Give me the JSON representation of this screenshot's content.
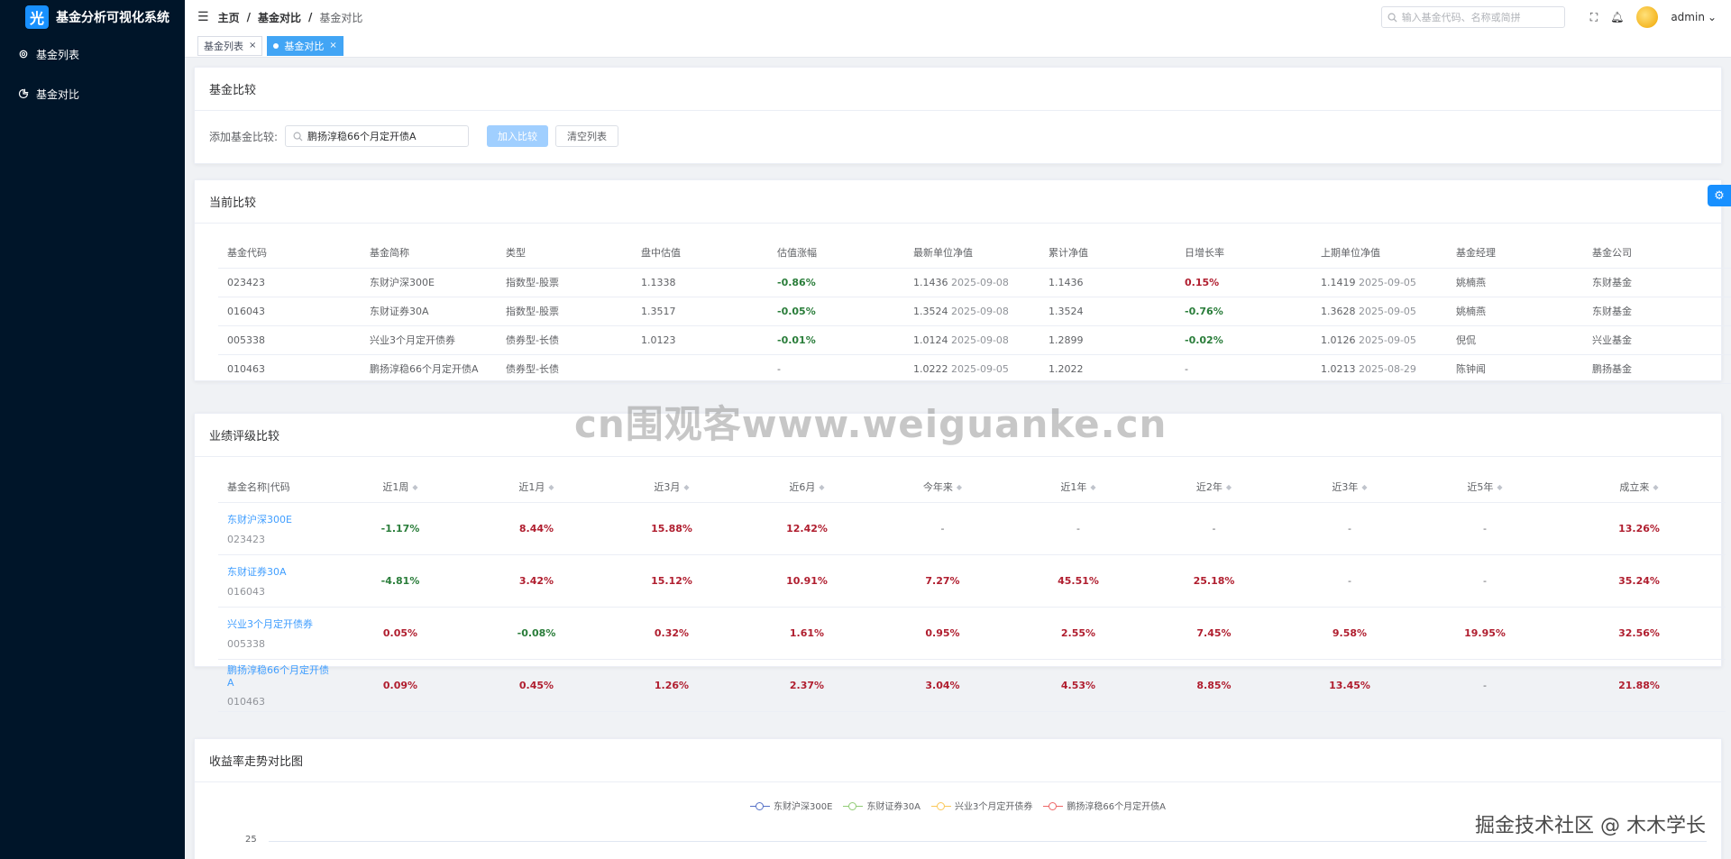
{
  "app": {
    "logo_char": "光",
    "title": "基金分析可视化系统"
  },
  "sidebar": {
    "items": [
      {
        "label": "基金列表",
        "icon": "gear-icon"
      },
      {
        "label": "基金对比",
        "icon": "pie-chart-icon"
      }
    ]
  },
  "header": {
    "breadcrumb": [
      "主页",
      "基金对比",
      "基金对比"
    ],
    "search_placeholder": "输入基金代码、名称或简拼",
    "user": "admin"
  },
  "tabs": [
    {
      "label": "基金列表",
      "active": false
    },
    {
      "label": "基金对比",
      "active": true
    }
  ],
  "compare": {
    "title": "基金比较",
    "add_label": "添加基金比较:",
    "input_value": "鹏扬淳稳66个月定开债A",
    "add_button": "加入比较",
    "clear_button": "清空列表"
  },
  "current": {
    "title": "当前比较",
    "columns": [
      "基金代码",
      "基金简称",
      "类型",
      "盘中估值",
      "估值涨幅",
      "最新单位净值",
      "累计净值",
      "日增长率",
      "上期单位净值",
      "基金经理",
      "基金公司"
    ],
    "rows": [
      {
        "code": "023423",
        "name": "东财沪深300E",
        "type": "指数型-股票",
        "est": "1.1338",
        "est_chg": "-0.86%",
        "est_dir": "down",
        "nav": "1.1436",
        "nav_date": "2025-09-08",
        "acc": "1.1436",
        "daily": "0.15%",
        "daily_dir": "up",
        "prev": "1.1419",
        "prev_date": "2025-09-05",
        "manager": "姚楠燕",
        "company": "东财基金"
      },
      {
        "code": "016043",
        "name": "东财证券30A",
        "type": "指数型-股票",
        "est": "1.3517",
        "est_chg": "-0.05%",
        "est_dir": "down",
        "nav": "1.3524",
        "nav_date": "2025-09-08",
        "acc": "1.3524",
        "daily": "-0.76%",
        "daily_dir": "down",
        "prev": "1.3628",
        "prev_date": "2025-09-05",
        "manager": "姚楠燕",
        "company": "东财基金"
      },
      {
        "code": "005338",
        "name": "兴业3个月定开债券",
        "type": "债券型-长债",
        "est": "1.0123",
        "est_chg": "-0.01%",
        "est_dir": "down",
        "nav": "1.0124",
        "nav_date": "2025-09-08",
        "acc": "1.2899",
        "daily": "-0.02%",
        "daily_dir": "down",
        "prev": "1.0126",
        "prev_date": "2025-09-05",
        "manager": "倪侃",
        "company": "兴业基金"
      },
      {
        "code": "010463",
        "name": "鹏扬淳稳66个月定开债A",
        "type": "债券型-长债",
        "est": "",
        "est_chg": "-",
        "est_dir": "none",
        "nav": "1.0222",
        "nav_date": "2025-09-05",
        "acc": "1.2022",
        "daily": "-",
        "daily_dir": "none",
        "prev": "1.0213",
        "prev_date": "2025-08-29",
        "manager": "陈钟闻",
        "company": "鹏扬基金"
      }
    ]
  },
  "performance": {
    "title": "业绩评级比较",
    "columns": [
      "基金名称|代码",
      "近1周",
      "近1月",
      "近3月",
      "近6月",
      "今年来",
      "近1年",
      "近2年",
      "近3年",
      "近5年",
      "成立来"
    ],
    "rows": [
      {
        "name": "东财沪深300E",
        "code": "023423",
        "values": [
          "-1.17%",
          "8.44%",
          "15.88%",
          "12.42%",
          "-",
          "-",
          "-",
          "-",
          "-",
          "13.26%"
        ]
      },
      {
        "name": "东财证券30A",
        "code": "016043",
        "values": [
          "-4.81%",
          "3.42%",
          "15.12%",
          "10.91%",
          "7.27%",
          "45.51%",
          "25.18%",
          "-",
          "-",
          "35.24%"
        ]
      },
      {
        "name": "兴业3个月定开债券",
        "code": "005338",
        "values": [
          "0.05%",
          "-0.08%",
          "0.32%",
          "1.61%",
          "0.95%",
          "2.55%",
          "7.45%",
          "9.58%",
          "19.95%",
          "32.56%"
        ]
      },
      {
        "name": "鹏扬淳稳66个月定开债A",
        "code": "010463",
        "values": [
          "0.09%",
          "0.45%",
          "1.26%",
          "2.37%",
          "3.04%",
          "4.53%",
          "8.85%",
          "13.45%",
          "-",
          "21.88%"
        ]
      }
    ]
  },
  "trend": {
    "title": "收益率走势对比图",
    "legend": [
      {
        "name": "东财沪深300E",
        "color": "#5470c6"
      },
      {
        "name": "东财证券30A",
        "color": "#91cc75"
      },
      {
        "name": "兴业3个月定开债券",
        "color": "#fac858"
      },
      {
        "name": "鹏扬淳稳66个月定开债A",
        "color": "#ee6666"
      }
    ],
    "y_tick": "25"
  },
  "overlay": {
    "watermark": "cn围观客www.weiguanke.cn",
    "credit": "掘金技术社区 @ 木木学长"
  },
  "colors": {
    "up": "#b01e2f",
    "down": "#2a7d3a",
    "sidebar": "#001529",
    "accent": "#409eff"
  }
}
